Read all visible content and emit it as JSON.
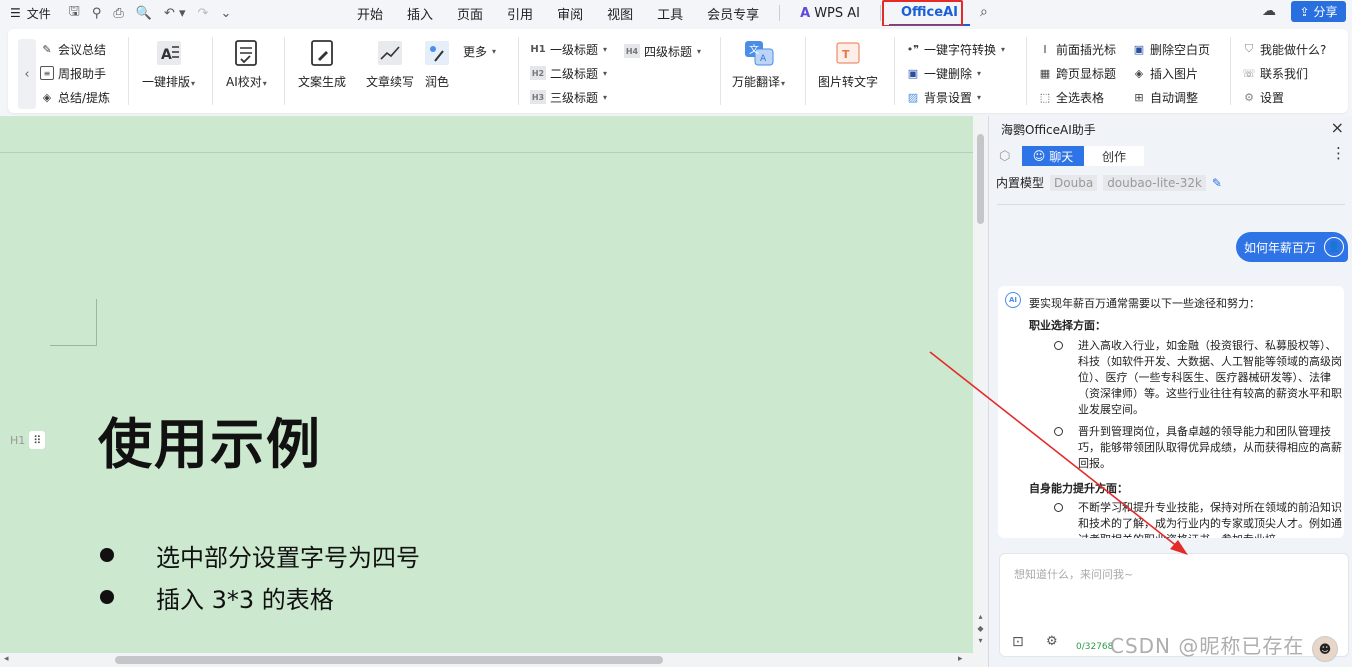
{
  "menubar": {
    "file_label": "文件",
    "tabs": [
      {
        "label": "开始"
      },
      {
        "label": "插入"
      },
      {
        "label": "页面"
      },
      {
        "label": "引用"
      },
      {
        "label": "审阅"
      },
      {
        "label": "视图"
      },
      {
        "label": "工具"
      },
      {
        "label": "会员专享"
      }
    ],
    "wps_ai": "WPS AI",
    "officeai": "OfficeAI",
    "share": "分享",
    "highlight_color": "#e52a2a"
  },
  "ribbon": {
    "col1": [
      "会议总结",
      "周报助手",
      "总结/提炼"
    ],
    "big1": "一键排版",
    "big2": "AI校对",
    "big3": "文案生成",
    "big4": "文章续写",
    "big5": "润色",
    "more": "更多",
    "headings_left": [
      "一级标题",
      "二级标题",
      "三级标题"
    ],
    "heading_prefixes": [
      "H1",
      "H2",
      "H3",
      "H4"
    ],
    "heading4": "四级标题",
    "translate": "万能翻译",
    "img2text": "图片转文字",
    "col_convert": [
      "一键字符转换",
      "一键删除",
      "背景设置"
    ],
    "col_cursor": [
      "前面插光标",
      "跨页显标题",
      "全选表格"
    ],
    "col_page": [
      "删除空白页",
      "插入图片",
      "自动调整"
    ],
    "col_help": [
      "我能做什么?",
      "联系我们",
      "设置"
    ]
  },
  "document": {
    "background": "#cce8cf",
    "heading_marker": "H1",
    "title": "使用示例",
    "bullets": [
      "选中部分设置字号为四号",
      "插入 3*3 的表格"
    ]
  },
  "panel": {
    "title": "海鹦OfficeAI助手",
    "tab_chat": "聊天",
    "tab_create": "创作",
    "model_label": "内置模型",
    "model_provider": "Douba",
    "model_name": "doubao-lite-32k",
    "user_message": "如何年薪百万",
    "ai_intro": "要实现年薪百万通常需要以下一些途径和努力：",
    "sections": [
      {
        "title": "职业选择方面：",
        "items": [
          "进入高收入行业，如金融（投资银行、私募股权等）、科技（如软件开发、大数据、人工智能等领域的高级岗位）、医疗（一些专科医生、医疗器械研发等）、法律（资深律师）等。这些行业往往有较高的薪资水平和职业发展空间。",
          "晋升到管理岗位，具备卓越的领导能力和团队管理技巧，能够带领团队取得优异成绩，从而获得相应的高薪回报。"
        ]
      },
      {
        "title": "自身能力提升方面：",
        "items": [
          "不断学习和提升专业技能，保持对所在领域的前沿知识和技术的了解，成为行业内的专家或顶尖人才。例如通过考取相关的职业资格证书，参加专业培"
        ]
      }
    ],
    "input_placeholder": "想知道什么，来问问我~",
    "char_count": "0/32768",
    "accent": "#2f74e6"
  },
  "watermark": "CSDN @昵称已存在"
}
